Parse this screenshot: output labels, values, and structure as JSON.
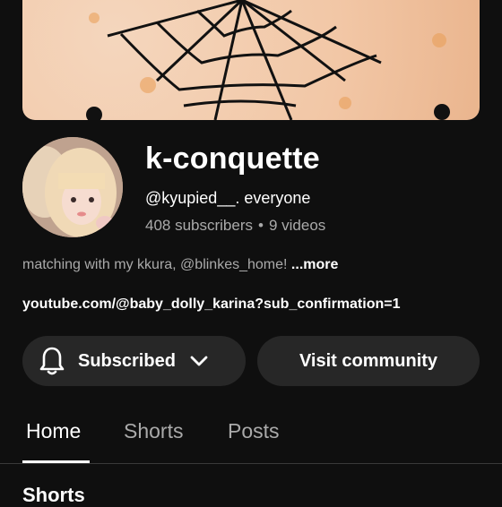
{
  "channel": {
    "name": "k-conquette",
    "handle": "@kyupied__. everyone",
    "subscribers": "408 subscribers",
    "separator": "•",
    "videos": "9 videos",
    "description": "matching with my kkura, @blinkes_home! ",
    "more_label": "...more",
    "link": "youtube.com/@baby_dolly_karina?sub_confirmation=1"
  },
  "actions": {
    "subscribed_label": "Subscribed",
    "community_label": "Visit community"
  },
  "tabs": [
    {
      "label": "Home",
      "active": true
    },
    {
      "label": "Shorts",
      "active": false
    },
    {
      "label": "Posts",
      "active": false
    }
  ],
  "section": {
    "heading": "Shorts"
  },
  "icons": {
    "bell": "bell-icon",
    "chevron": "chevron-down-icon"
  },
  "colors": {
    "background": "#0f0f0f",
    "button": "#272727",
    "secondary_text": "#aaaaaa",
    "banner": "#f2c7a6"
  }
}
